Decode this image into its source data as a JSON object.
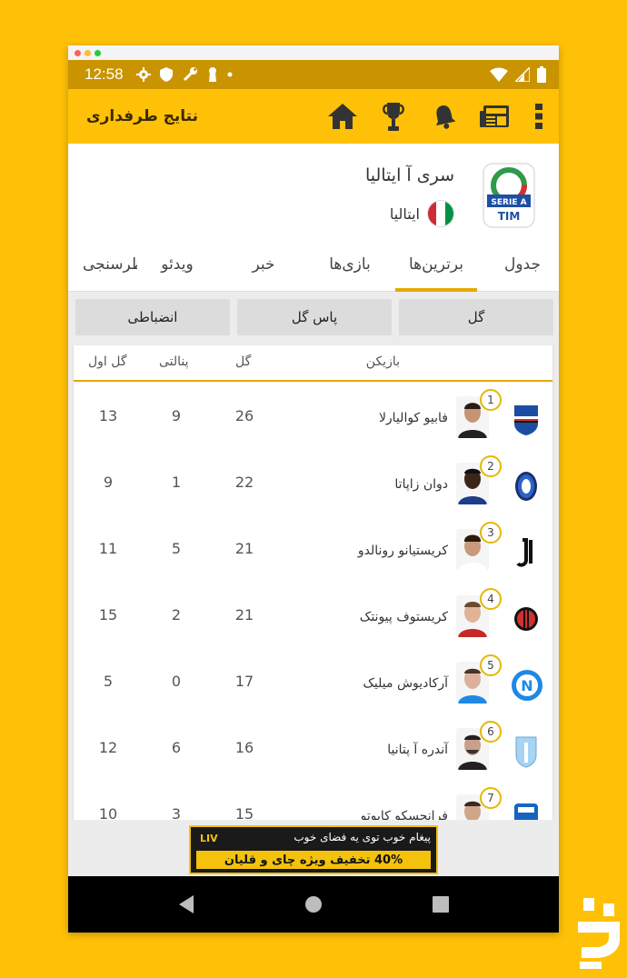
{
  "status": {
    "time": "12:58"
  },
  "appbar": {
    "title": "نتایج طرفداری"
  },
  "league": {
    "name": "سری آ ایتالیا",
    "country": "ایتالیا",
    "logo_text": "SERIE A",
    "sponsor": "TIM"
  },
  "tabs": [
    {
      "label": "جدول"
    },
    {
      "label": "برترین‌ها"
    },
    {
      "label": "بازی‌ها"
    },
    {
      "label": "خبر"
    },
    {
      "label": "ویدئو"
    },
    {
      "label": "نظرسنجی"
    }
  ],
  "segments": [
    {
      "label": "گل"
    },
    {
      "label": "پاس گل"
    },
    {
      "label": "انضباطی"
    }
  ],
  "table": {
    "headers": {
      "player": "بازیکن",
      "goals": "گل",
      "penalty": "پنالتی",
      "first_goal": "گل اول"
    },
    "rows": [
      {
        "rank": "1",
        "name": "فابیو کوالیارلا",
        "goals": "26",
        "penalty": "9",
        "first_goal": "13"
      },
      {
        "rank": "2",
        "name": "دوان زاپاتا",
        "goals": "22",
        "penalty": "1",
        "first_goal": "9"
      },
      {
        "rank": "3",
        "name": "کریستیانو رونالدو",
        "goals": "21",
        "penalty": "5",
        "first_goal": "11"
      },
      {
        "rank": "4",
        "name": "کریستوف پیونتک",
        "goals": "21",
        "penalty": "2",
        "first_goal": "15"
      },
      {
        "rank": "5",
        "name": "آرکادیوش میلیک",
        "goals": "17",
        "penalty": "0",
        "first_goal": "5"
      },
      {
        "rank": "6",
        "name": "آندره آ پتانیا",
        "goals": "16",
        "penalty": "6",
        "first_goal": "12"
      },
      {
        "rank": "7",
        "name": "فرانچسکو کاپوتو",
        "goals": "15",
        "penalty": "3",
        "first_goal": "10"
      }
    ]
  },
  "ad": {
    "headline": "پیغام خوب توی یه فضای خوب",
    "offer": "40% تخفیف ویژه چای و قلیان",
    "brand": "LIV"
  },
  "colors": {
    "primary": "#FFC107",
    "status": "#C99400",
    "accent": "#E5A900"
  }
}
